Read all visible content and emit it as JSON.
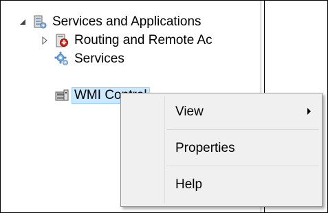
{
  "tree": {
    "items": [
      {
        "label": "Services and Applications",
        "expander": "expanded",
        "icon": "services-applications-icon"
      },
      {
        "label": "Routing and Remote Ac",
        "expander": "collapsed",
        "icon": "routing-remote-access-icon"
      },
      {
        "label": "Services",
        "expander": "none",
        "icon": "services-gear-icon"
      },
      {
        "label": "WMI Control",
        "expander": "none",
        "icon": "wmi-control-icon",
        "selected": true
      }
    ]
  },
  "context_menu": {
    "items": [
      {
        "label": "View",
        "has_submenu": true
      },
      {
        "label": "Properties",
        "has_submenu": false
      },
      {
        "label": "Help",
        "has_submenu": false
      }
    ]
  },
  "colors": {
    "selection_fill": "#cce8ff",
    "selection_border": "#99d1ff",
    "menu_background": "#f0f0f0"
  }
}
